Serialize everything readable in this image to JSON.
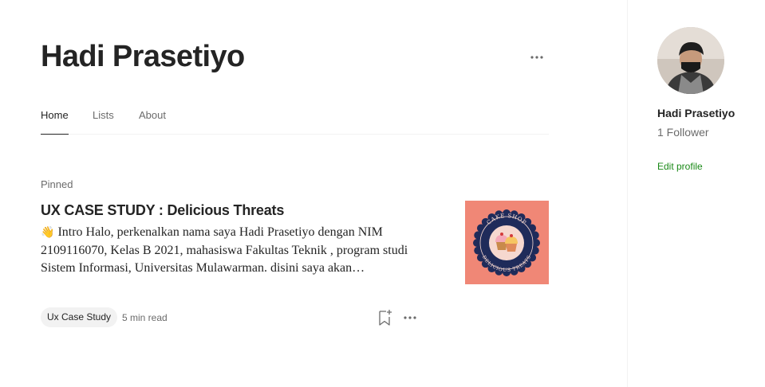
{
  "profile": {
    "name": "Hadi Prasetiyo"
  },
  "tabs": [
    {
      "label": "Home",
      "active": true
    },
    {
      "label": "Lists",
      "active": false
    },
    {
      "label": "About",
      "active": false
    }
  ],
  "post": {
    "pinned_label": "Pinned",
    "title": "UX CASE STUDY : Delicious Threats",
    "excerpt_emoji": "👋",
    "excerpt": " Intro Halo, perkenalkan nama saya Hadi Prasetiyo dengan NIM 2109116070, Kelas B 2021, mahasiswa Fakultas Teknik , program studi Sistem Informasi, Universitas Mulawarman. disini saya akan…",
    "thumbnail": {
      "top_text": "CAKE SHOP",
      "bottom_text": "DELICIOUS TREATS",
      "background": "#f08776",
      "badge_color": "#1f2b5a"
    },
    "tag": "Ux Case Study",
    "read_time": "5 min read"
  },
  "sidebar": {
    "name": "Hadi Prasetiyo",
    "followers": "1 Follower",
    "edit_profile": "Edit profile"
  },
  "colors": {
    "text_primary": "#242424",
    "text_secondary": "#6b6b6b",
    "accent_green": "#1a8917",
    "divider": "#f2f2f2"
  },
  "icons": [
    "more-horizontal-icon",
    "bookmark-add-icon"
  ]
}
